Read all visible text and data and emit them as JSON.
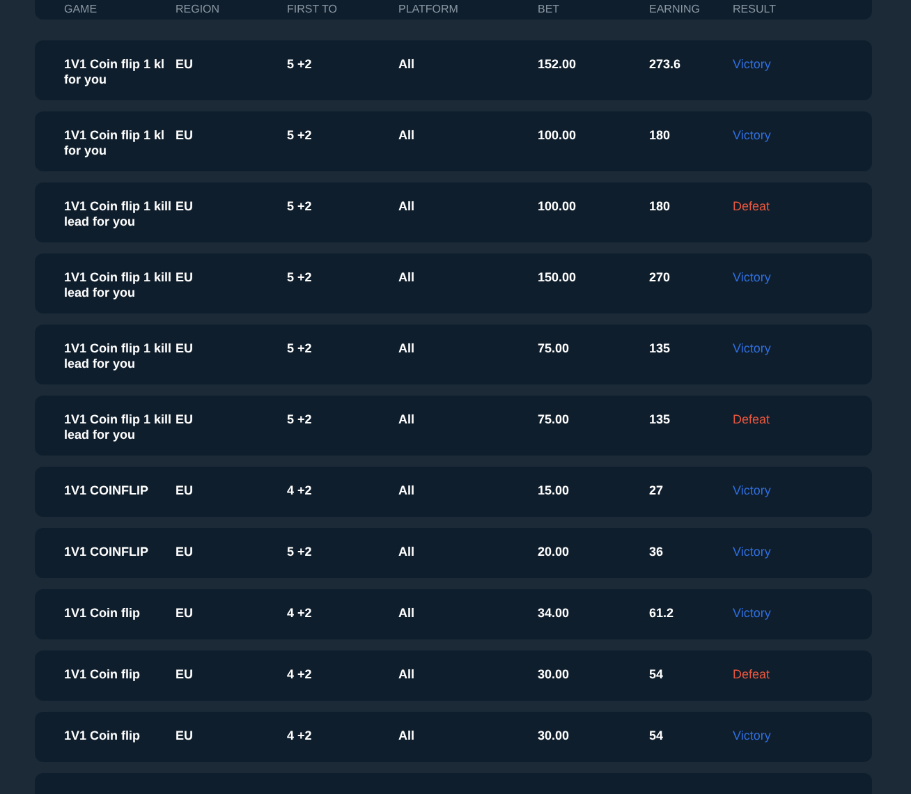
{
  "table": {
    "columns": [
      "GAME",
      "REGION",
      "FIRST TO",
      "PLATFORM",
      "BET",
      "EARNING",
      "RESULT"
    ],
    "rows": [
      {
        "game": "1V1 Coin flip 1 kl for you",
        "region": "EU",
        "first_to": "5 +2",
        "platform": "All",
        "bet": "152.00",
        "earning": "273.6",
        "result": "Victory",
        "kind": "win"
      },
      {
        "game": "1V1 Coin flip 1 kl for you",
        "region": "EU",
        "first_to": "5 +2",
        "platform": "All",
        "bet": "100.00",
        "earning": "180",
        "result": "Victory",
        "kind": "win"
      },
      {
        "game": "1V1 Coin flip 1 kill lead for you",
        "region": "EU",
        "first_to": "5 +2",
        "platform": "All",
        "bet": "100.00",
        "earning": "180",
        "result": "Defeat",
        "kind": "loss"
      },
      {
        "game": "1V1 Coin flip 1 kill lead for you",
        "region": "EU",
        "first_to": "5 +2",
        "platform": "All",
        "bet": "150.00",
        "earning": "270",
        "result": "Victory",
        "kind": "win"
      },
      {
        "game": "1V1 Coin flip 1 kill lead for you",
        "region": "EU",
        "first_to": "5 +2",
        "platform": "All",
        "bet": "75.00",
        "earning": "135",
        "result": "Victory",
        "kind": "win"
      },
      {
        "game": "1V1 Coin flip 1 kill lead for you",
        "region": "EU",
        "first_to": "5 +2",
        "platform": "All",
        "bet": "75.00",
        "earning": "135",
        "result": "Defeat",
        "kind": "loss"
      },
      {
        "game": "1V1 COINFLIP",
        "region": "EU",
        "first_to": "4 +2",
        "platform": "All",
        "bet": "15.00",
        "earning": "27",
        "result": "Victory",
        "kind": "win"
      },
      {
        "game": "1V1 COINFLIP",
        "region": "EU",
        "first_to": "5 +2",
        "platform": "All",
        "bet": "20.00",
        "earning": "36",
        "result": "Victory",
        "kind": "win"
      },
      {
        "game": "1V1 Coin flip",
        "region": "EU",
        "first_to": "4 +2",
        "platform": "All",
        "bet": "34.00",
        "earning": "61.2",
        "result": "Victory",
        "kind": "win"
      },
      {
        "game": "1V1 Coin flip",
        "region": "EU",
        "first_to": "4 +2",
        "platform": "All",
        "bet": "30.00",
        "earning": "54",
        "result": "Defeat",
        "kind": "loss"
      },
      {
        "game": "1V1 Coin flip",
        "region": "EU",
        "first_to": "4 +2",
        "platform": "All",
        "bet": "30.00",
        "earning": "54",
        "result": "Victory",
        "kind": "win"
      }
    ]
  }
}
